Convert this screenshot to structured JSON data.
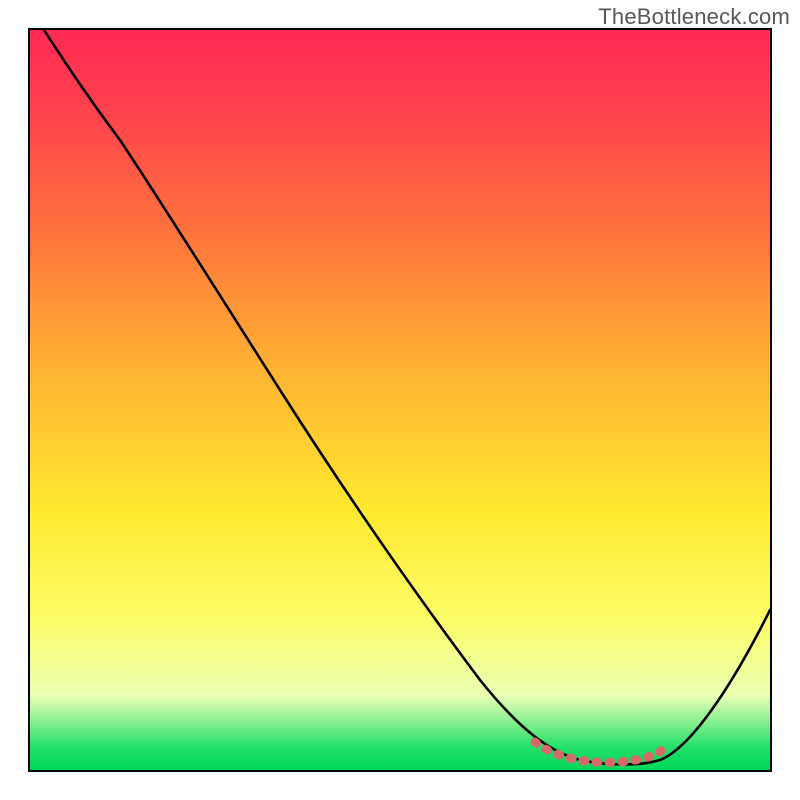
{
  "watermark": "TheBottleneck.com",
  "chart_data": {
    "type": "line",
    "title": "",
    "xlabel": "",
    "ylabel": "",
    "xlim": [
      0,
      100
    ],
    "ylim": [
      0,
      100
    ],
    "grid": false,
    "legend": false,
    "series": [
      {
        "name": "bottleneck-curve",
        "x": [
          2,
          6,
          10,
          15,
          20,
          25,
          30,
          35,
          40,
          45,
          50,
          55,
          58,
          62,
          66,
          70,
          74,
          78,
          82,
          85,
          90,
          95,
          100
        ],
        "y": [
          100,
          97,
          93,
          88,
          82,
          75,
          68,
          61,
          54,
          47,
          40,
          32,
          27,
          21,
          14,
          8,
          4,
          1.5,
          0.5,
          0.5,
          2,
          10,
          22
        ]
      },
      {
        "name": "highlight-band",
        "x": [
          71,
          73,
          75,
          77,
          79,
          81,
          83,
          85
        ],
        "y": [
          3.2,
          2.4,
          1.6,
          1.1,
          0.8,
          0.8,
          0.9,
          1.3
        ]
      }
    ],
    "colors": {
      "curve": "#000000",
      "highlight": "#d66a6a",
      "gradient_stops": [
        "#ff2a55",
        "#ff6c3f",
        "#ffe92f",
        "#00d85a"
      ]
    }
  }
}
